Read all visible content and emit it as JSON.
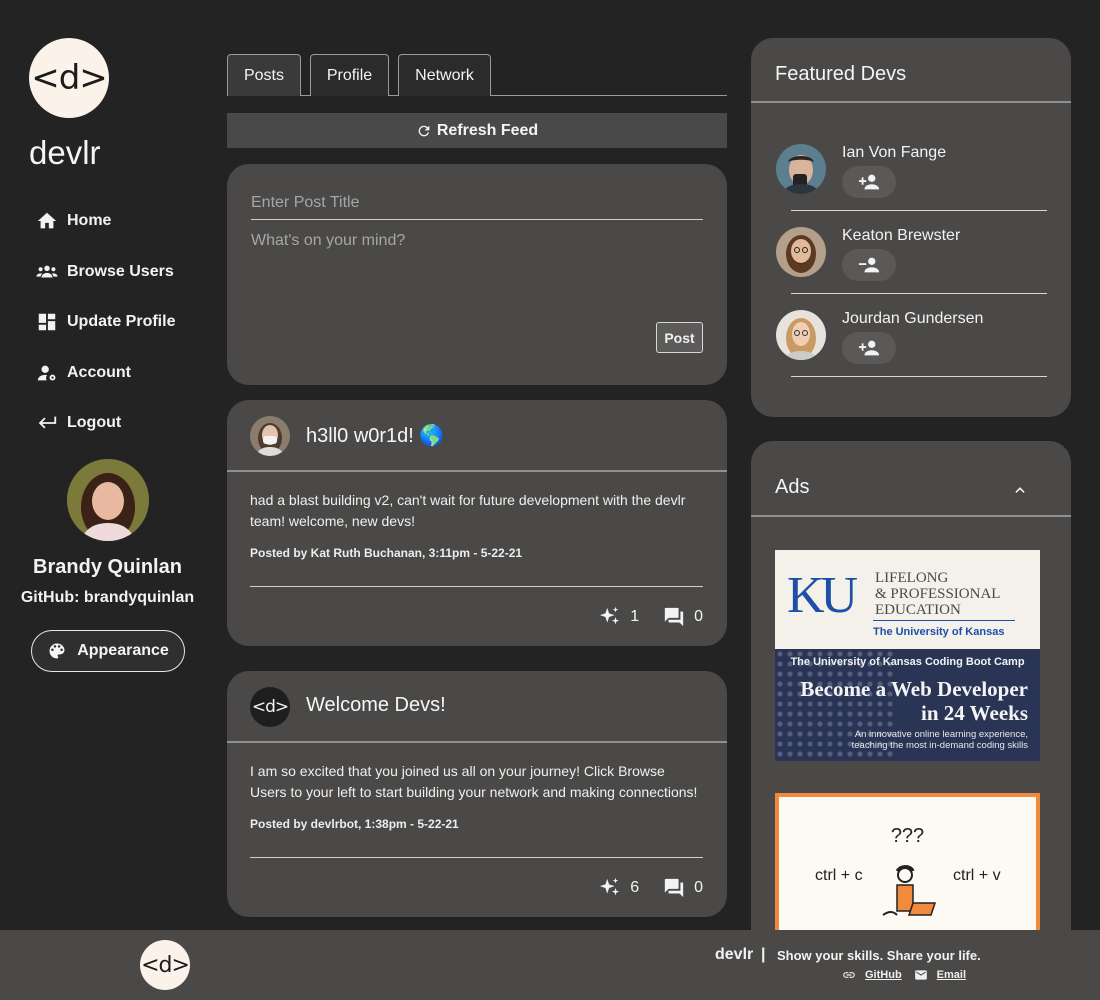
{
  "brand": {
    "logo_text": "<d>",
    "name": "devlr"
  },
  "nav": {
    "items": [
      {
        "label": "Home",
        "icon": "home-icon"
      },
      {
        "label": "Browse Users",
        "icon": "people-icon"
      },
      {
        "label": "Update Profile",
        "icon": "dashboard-icon"
      },
      {
        "label": "Account",
        "icon": "manage-account-icon"
      },
      {
        "label": "Logout",
        "icon": "logout-arrow-icon"
      }
    ]
  },
  "user": {
    "name": "Brandy Quinlan",
    "github": "GitHub: brandyquinlan"
  },
  "appearance_label": "Appearance",
  "tabs": [
    {
      "label": "Posts"
    },
    {
      "label": "Profile"
    },
    {
      "label": "Network"
    }
  ],
  "active_tab": "Posts",
  "refresh_label": "Refresh Feed",
  "new_post": {
    "title_placeholder": "Enter Post Title",
    "body_placeholder": "What's on your mind?",
    "post_label": "Post"
  },
  "posts": [
    {
      "title": "h3ll0 w0r1d! 🌎",
      "body": "had a blast building v2, can't wait for future development with the devlr team! welcome, new devs!",
      "meta": "Posted by Kat Ruth Buchanan, 3:11pm - 5-22-21",
      "likes": "1",
      "comments": "0"
    },
    {
      "avatar_text": "<d>",
      "title": "Welcome Devs!",
      "body": "I am so excited that you joined us all on your journey! Click Browse Users to your left to start building your network and making connections!",
      "meta": "Posted by devlrbot, 1:38pm - 5-22-21",
      "likes": "6",
      "comments": "0"
    }
  ],
  "featured": {
    "title": "Featured Devs",
    "devs": [
      {
        "name": "Ian Von Fange",
        "action_icon": "person-add-icon"
      },
      {
        "name": "Keaton Brewster",
        "action_icon": "person-remove-icon"
      },
      {
        "name": "Jourdan Gundersen",
        "action_icon": "person-add-icon"
      }
    ]
  },
  "ads": {
    "title": "Ads",
    "ad1": {
      "logo": "KU",
      "line1": "LIFELONG",
      "line2": "& PROFESSIONAL",
      "line3": "EDUCATION",
      "university": "The University of Kansas",
      "bootcamp": "The University of Kansas Coding Boot Camp",
      "headline1": "Become a Web Developer",
      "headline2": "in 24 Weeks",
      "sub1": "An innovative online learning experience,",
      "sub2": "teaching the most in-demand coding skills"
    },
    "ad2": {
      "question": "???",
      "left": "ctrl + c",
      "right": "ctrl + v"
    }
  },
  "footer": {
    "logo_text": "<d>",
    "brand": "devlr",
    "separator": "|",
    "tagline": "Show your skills. Share your life.",
    "links": [
      {
        "label": "GitHub"
      },
      {
        "label": "Email"
      }
    ]
  },
  "colors": {
    "background": "#232323",
    "card": "#4a4948",
    "logo_bg": "#fbf3ea",
    "ad_orange": "#f08a3c",
    "ku_blue": "#1e4fa8"
  }
}
